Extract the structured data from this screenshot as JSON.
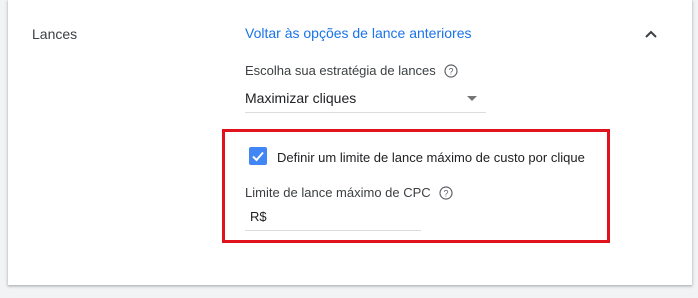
{
  "section": {
    "title": "Lances",
    "back_link": "Voltar às opções de lance anteriores"
  },
  "strategy": {
    "label": "Escolha sua estratégia de lances",
    "selected": "Maximizar cliques"
  },
  "max_cpc": {
    "checkbox_label": "Definir um limite de lance máximo de custo por clique",
    "checked": true,
    "label": "Limite de lance máximo de CPC",
    "currency_prefix": "R$",
    "value": ""
  },
  "colors": {
    "accent": "#1a73e8",
    "checkbox": "#4285f4",
    "highlight": "#e0121b"
  },
  "icons": [
    "chevron-up-icon",
    "help-icon",
    "checkmark-icon",
    "dropdown-arrow-icon"
  ]
}
